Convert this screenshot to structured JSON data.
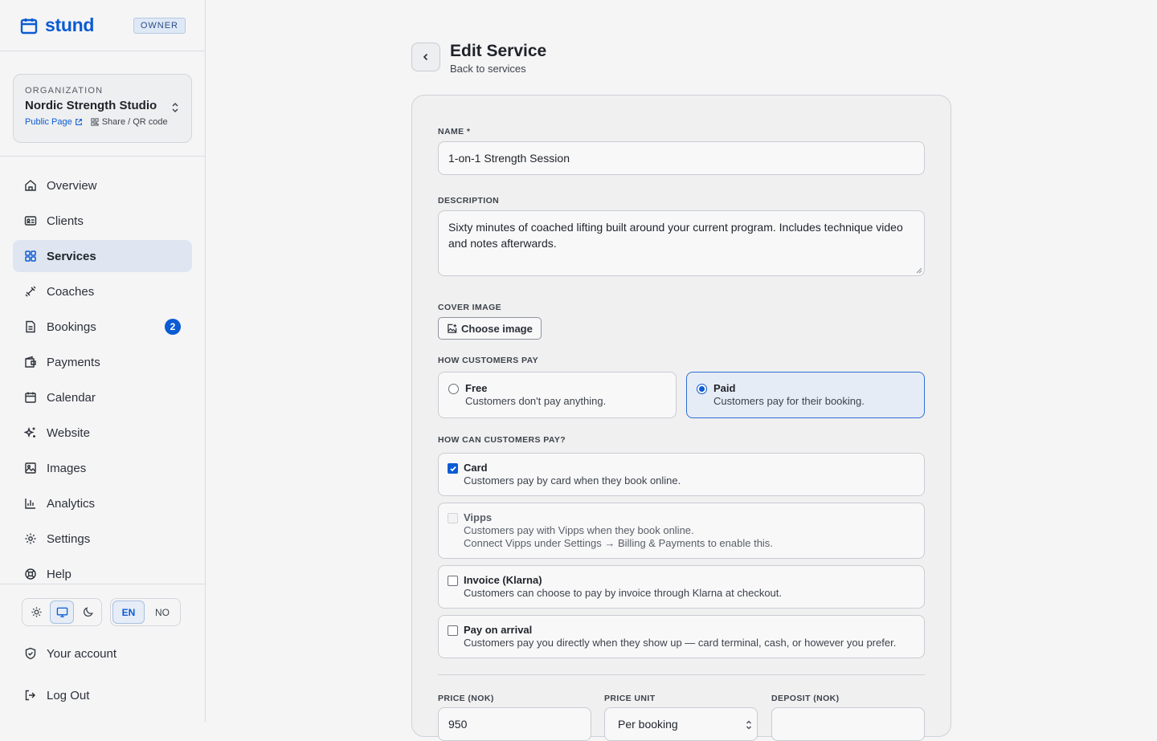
{
  "brand": {
    "name": "stund",
    "role_badge": "OWNER",
    "accent": "#0b5bd3"
  },
  "org": {
    "label": "ORGANIZATION",
    "name": "Nordic Strength Studio",
    "public_page": "Public Page",
    "share": "Share / QR code"
  },
  "nav": {
    "items": [
      {
        "label": "Overview",
        "icon": "home-icon"
      },
      {
        "label": "Clients",
        "icon": "id-card-icon"
      },
      {
        "label": "Services",
        "icon": "grid-icon",
        "active": true
      },
      {
        "label": "Coaches",
        "icon": "dumbbell-icon"
      },
      {
        "label": "Bookings",
        "icon": "document-icon",
        "badge": "2"
      },
      {
        "label": "Payments",
        "icon": "wallet-icon"
      },
      {
        "label": "Calendar",
        "icon": "calendar-icon"
      },
      {
        "label": "Website",
        "icon": "sparkles-icon"
      },
      {
        "label": "Images",
        "icon": "image-icon"
      },
      {
        "label": "Analytics",
        "icon": "bar-chart-icon"
      },
      {
        "label": "Settings",
        "icon": "gear-icon"
      },
      {
        "label": "Help",
        "icon": "lifebuoy-icon"
      }
    ]
  },
  "toggles": {
    "theme_selected": "system",
    "lang_en": "EN",
    "lang_no": "NO",
    "lang_selected": "EN"
  },
  "account": {
    "your_account": "Your account",
    "logout": "Log Out"
  },
  "page": {
    "title": "Edit Service",
    "subtitle": "Back to services"
  },
  "form": {
    "name_label": "NAME *",
    "name_value": "1-on-1 Strength Session",
    "description_label": "DESCRIPTION",
    "description_value": "Sixty minutes of coached lifting built around your current program. Includes technique video and notes afterwards.",
    "cover_label": "COVER IMAGE",
    "choose_image": "Choose image",
    "how_pay_label": "HOW CUSTOMERS PAY",
    "pay_free_title": "Free",
    "pay_free_desc": "Customers don't pay anything.",
    "pay_paid_title": "Paid",
    "pay_paid_desc": "Customers pay for their booking.",
    "pay_selected": "Paid",
    "methods_label": "HOW CAN CUSTOMERS PAY?",
    "methods": {
      "card": {
        "title": "Card",
        "desc": "Customers pay by card when they book online.",
        "checked": true
      },
      "vipps": {
        "title": "Vipps",
        "desc": "Customers pay with Vipps when they book online.",
        "note": "Connect Vipps under Settings → Billing & Payments to enable this.",
        "disabled": true
      },
      "klarna": {
        "title": "Invoice (Klarna)",
        "desc": "Customers can choose to pay by invoice through Klarna at checkout.",
        "checked": false
      },
      "arrival": {
        "title": "Pay on arrival",
        "desc": "Customers pay you directly when they show up — card terminal, cash, or however you prefer.",
        "checked": false
      }
    },
    "price_label": "PRICE (NOK)",
    "price_value": "950",
    "price_unit_label": "PRICE UNIT",
    "price_unit_value": "Per booking",
    "deposit_label": "DEPOSIT (NOK)",
    "deposit_value": ""
  }
}
